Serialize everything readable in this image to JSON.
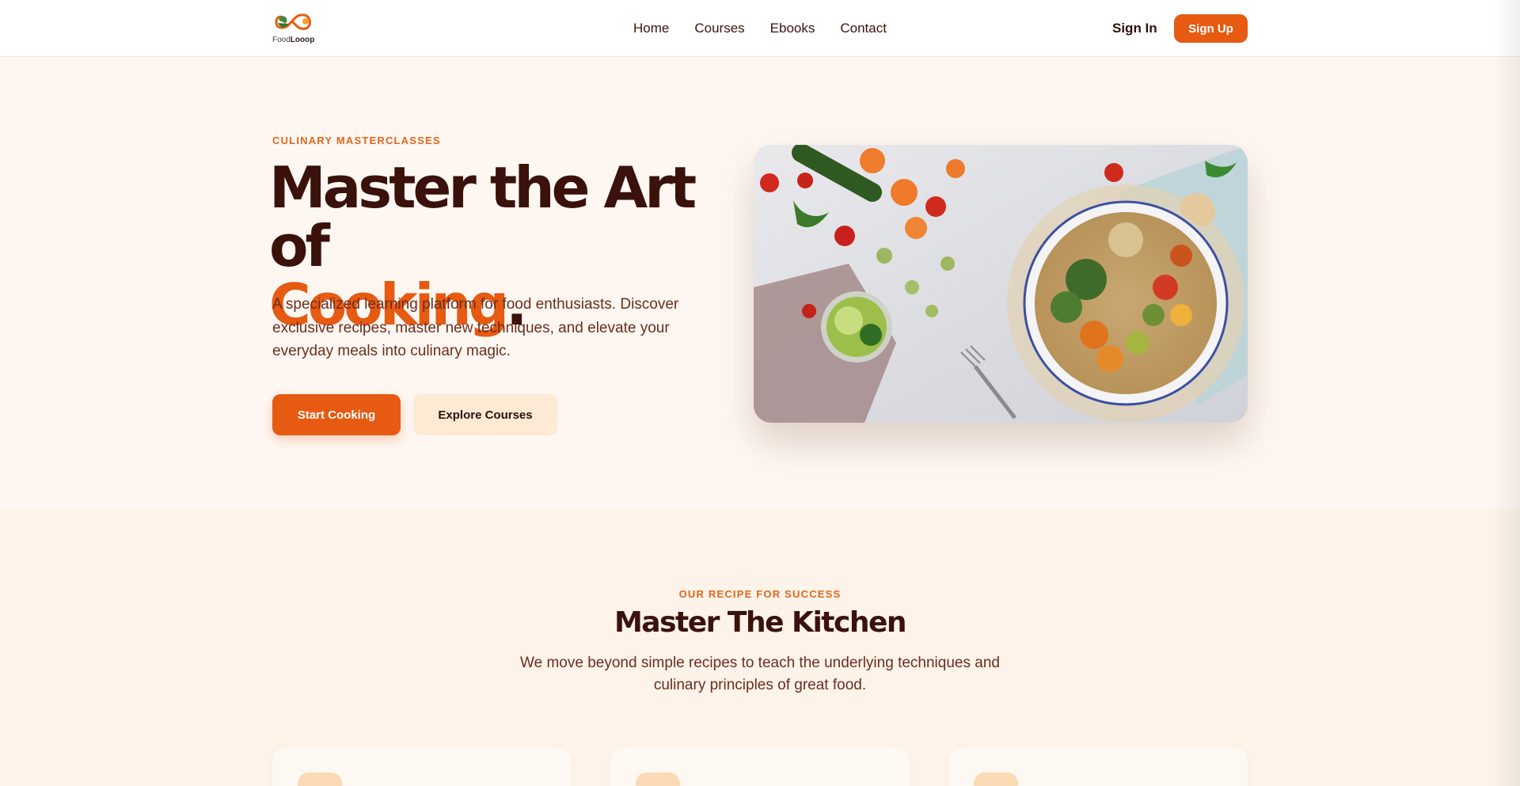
{
  "nav": {
    "logo_text_light": "Food",
    "logo_text_bold": "Looop",
    "links": [
      "Home",
      "Courses",
      "Ebooks",
      "Contact"
    ],
    "signin": "Sign In",
    "signup": "Sign Up"
  },
  "hero": {
    "eyebrow": "CULINARY MASTERCLASSES",
    "title_line1": "Master the Art of",
    "title_accent": "Cooking",
    "title_period": ".",
    "description": "A specialized learning platform for food enthusiasts. Discover exclusive recipes, master new techniques, and elevate your everyday meals into culinary magic.",
    "primary_button": "Start Cooking",
    "secondary_button": "Explore Courses"
  },
  "section": {
    "eyebrow": "OUR RECIPE FOR SUCCESS",
    "title": "Master The Kitchen",
    "description": "We move beyond simple recipes to teach the underlying techniques and culinary principles of great food."
  },
  "colors": {
    "accent": "#e65a12",
    "heading": "#3b110b",
    "background": "#fef7f1"
  }
}
